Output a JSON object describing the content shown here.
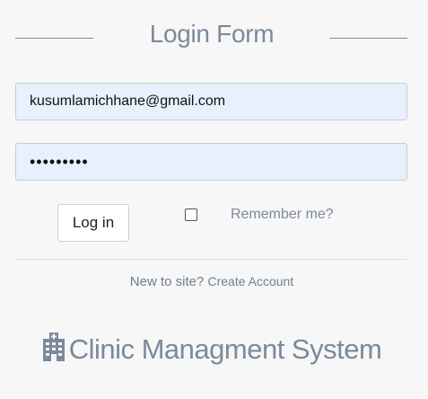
{
  "header": {
    "title": "Login Form"
  },
  "form": {
    "email_value": "kusumlamichhane@gmail.com",
    "password_value": "•••••••••",
    "login_label": "Log in",
    "remember_label": "Remember me?",
    "remember_checked": false
  },
  "signup": {
    "prompt": "New to site?",
    "link_label": "Create Account"
  },
  "brand": {
    "icon": "hospital-building-icon",
    "name": "Clinic Managment System"
  },
  "colors": {
    "background": "#f7f7f7",
    "title_text": "#7b8a9a",
    "input_fill": "#e8f0fe"
  }
}
